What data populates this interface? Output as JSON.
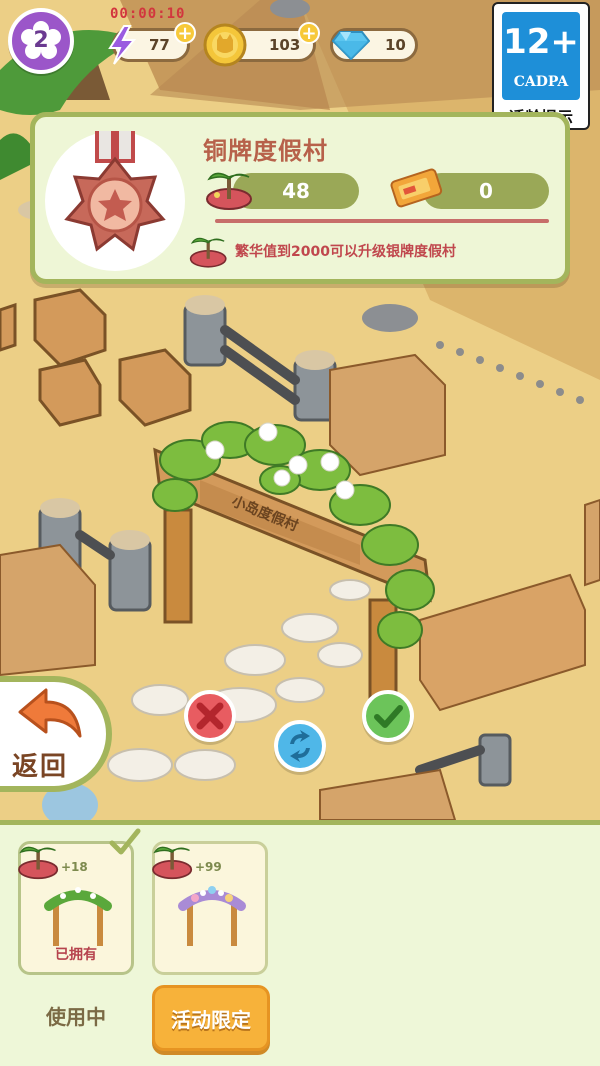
{
  "hud": {
    "level": "2",
    "timer": "00:00:10",
    "energy": "77",
    "coins": "103",
    "gems": "10",
    "plus": "+"
  },
  "age_rating": {
    "number": "12+",
    "org": "CADPA",
    "label": "适龄提示"
  },
  "resort": {
    "title": "铜牌度假村",
    "prosperity": "48",
    "tickets": "0",
    "hint": "繁华值到2000可以升级银牌度假村"
  },
  "scene": {
    "gate_sign": "小岛度假村"
  },
  "back_button": {
    "label": "返回"
  },
  "items": [
    {
      "badge": "+18",
      "status": "已拥有",
      "action": "使用中"
    },
    {
      "badge": "+99",
      "status": "",
      "action": "活动限定"
    }
  ]
}
